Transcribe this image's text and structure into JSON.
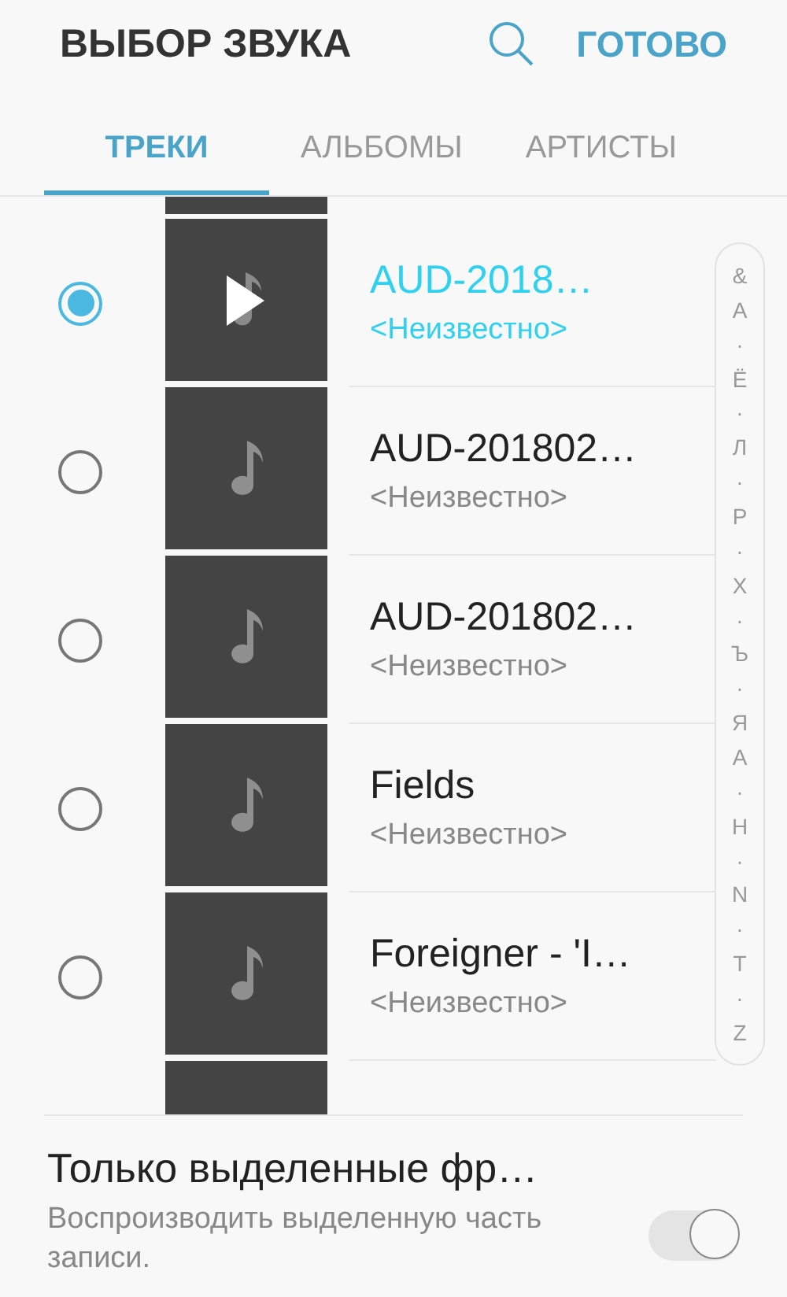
{
  "header": {
    "title": "ВЫБОР ЗВУКА",
    "done": "ГОТОВО"
  },
  "tabs": [
    {
      "label": "ТРЕКИ",
      "selected": true
    },
    {
      "label": "АЛЬБОМЫ",
      "selected": false
    },
    {
      "label": "АРТИСТЫ",
      "selected": false
    }
  ],
  "tracks": [
    {
      "title": "AUD-2018…",
      "subtitle": "<Неизвестно>",
      "selected": true,
      "playing": true
    },
    {
      "title": "AUD-201802…",
      "subtitle": "<Неизвестно>",
      "selected": false,
      "playing": false
    },
    {
      "title": "AUD-201802…",
      "subtitle": "<Неизвестно>",
      "selected": false,
      "playing": false
    },
    {
      "title": "Fields",
      "subtitle": "<Неизвестно>",
      "selected": false,
      "playing": false
    },
    {
      "title": "Foreigner - 'I…",
      "subtitle": "<Неизвестно>",
      "selected": false,
      "playing": false
    }
  ],
  "index": [
    "&",
    "А",
    "·",
    "Ё",
    "·",
    "Л",
    "·",
    "Р",
    "·",
    "Х",
    "·",
    "Ъ",
    "·",
    "Я",
    "A",
    "·",
    "H",
    "·",
    "N",
    "·",
    "T",
    "·",
    "Z"
  ],
  "option": {
    "title": "Только выделенные фр…",
    "description": "Воспроизводить выделенную часть записи.",
    "on": true,
    "disabled": true
  }
}
